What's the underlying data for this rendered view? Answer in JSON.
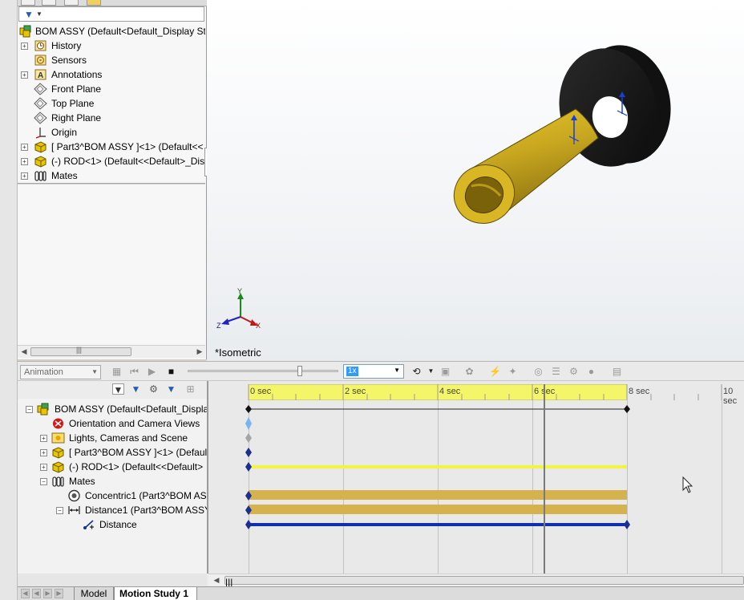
{
  "feature_tree": {
    "items": [
      {
        "label": "BOM ASSY  (Default<Default_Display Sta",
        "icon": "assembly-icon",
        "expander": "",
        "indent": 0
      },
      {
        "label": "History",
        "icon": "history-icon",
        "expander": "+",
        "indent": 1
      },
      {
        "label": "Sensors",
        "icon": "sensor-icon",
        "expander": "",
        "indent": 1
      },
      {
        "label": "Annotations",
        "icon": "annotation-icon",
        "expander": "+",
        "indent": 1
      },
      {
        "label": "Front Plane",
        "icon": "plane-icon",
        "expander": "",
        "indent": 1
      },
      {
        "label": "Top Plane",
        "icon": "plane-icon",
        "expander": "",
        "indent": 1
      },
      {
        "label": "Right Plane",
        "icon": "plane-icon",
        "expander": "",
        "indent": 1
      },
      {
        "label": "Origin",
        "icon": "origin-icon",
        "expander": "",
        "indent": 1
      },
      {
        "label": "[ Part3^BOM ASSY ]<1> (Default<<",
        "icon": "part-icon",
        "expander": "+",
        "indent": 1
      },
      {
        "label": "(-) ROD<1> (Default<<Default>_Dis",
        "icon": "part-icon",
        "expander": "+",
        "indent": 1
      },
      {
        "label": "Mates",
        "icon": "mates-icon",
        "expander": "+",
        "indent": 1
      }
    ]
  },
  "viewport": {
    "view_label": "*Isometric",
    "axes": {
      "x": "X",
      "y": "Y",
      "z": "Z"
    }
  },
  "motion_manager": {
    "study_type": "Animation",
    "speed": "1x",
    "ruler_labels": [
      "0 sec",
      "2 sec",
      "4 sec",
      "6 sec",
      "8 sec",
      "10 sec"
    ],
    "tree": [
      {
        "label": "BOM ASSY  (Default<Default_Displa",
        "icon": "assembly-icon",
        "expander": "−",
        "indent": 0
      },
      {
        "label": "Orientation and Camera Views",
        "icon": "camera-views-icon",
        "expander": "",
        "indent": 1
      },
      {
        "label": "Lights, Cameras and Scene",
        "icon": "lights-icon",
        "expander": "+",
        "indent": 1
      },
      {
        "label": "[ Part3^BOM ASSY ]<1> (Defaul",
        "icon": "part-icon",
        "expander": "+",
        "indent": 1
      },
      {
        "label": "(-) ROD<1> (Default<<Default>",
        "icon": "part-icon",
        "expander": "+",
        "indent": 1
      },
      {
        "label": "Mates",
        "icon": "mates-icon",
        "expander": "−",
        "indent": 1
      },
      {
        "label": "Concentric1 (Part3^BOM AS",
        "icon": "concentric-icon",
        "expander": "",
        "indent": 2
      },
      {
        "label": "Distance1 (Part3^BOM ASSY",
        "icon": "distance-icon",
        "expander": "−",
        "indent": 2
      },
      {
        "label": "Distance",
        "icon": "distance-value-icon",
        "expander": "",
        "indent": 3
      }
    ]
  },
  "bottom_tabs": {
    "model": "Model",
    "motion_study": "Motion Study 1"
  },
  "colors": {
    "rod": "#c8a820",
    "disc": "#1c1c1c",
    "timeline_yellow": "#f5f56a",
    "gold_bar": "#d6b24f",
    "blue_bar": "#1030b0",
    "key_point": "#1a2f8f"
  }
}
